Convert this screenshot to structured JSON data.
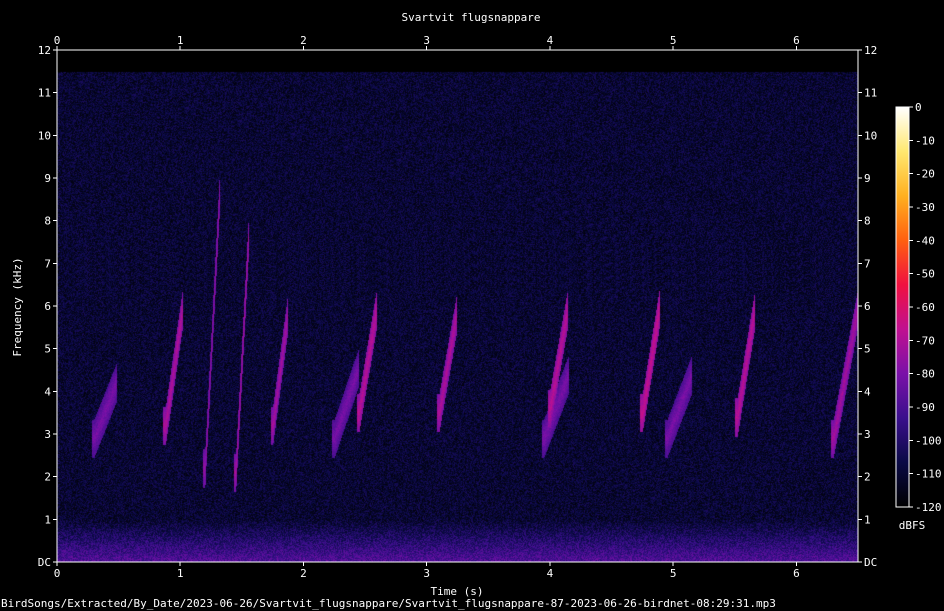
{
  "chart_data": {
    "type": "heatmap",
    "title": "Svartvit flugsnappare",
    "xlabel": "Time (s)",
    "ylabel": "Frequency (kHz)",
    "xlim": [
      0,
      6.5
    ],
    "ylim": [
      0,
      12
    ],
    "x_ticks": [
      "0",
      "1",
      "2",
      "3",
      "4",
      "5",
      "6"
    ],
    "y_ticks": [
      "DC",
      "1",
      "2",
      "3",
      "4",
      "5",
      "6",
      "7",
      "8",
      "9",
      "10",
      "11",
      "12"
    ],
    "colorbar": {
      "label": "dBFS",
      "range": [
        -120,
        0
      ],
      "ticks": [
        "0",
        "-10",
        "-20",
        "-30",
        "-40",
        "-50",
        "-60",
        "-70",
        "-80",
        "-90",
        "-100",
        "-110",
        "-120"
      ],
      "colors": [
        "#000000",
        "#0a0a45",
        "#3a0f8c",
        "#7a10a8",
        "#c01090",
        "#f01040",
        "#ff6010",
        "#ffb020",
        "#ffe870",
        "#ffffff"
      ]
    },
    "noise_floor_dbfs": -110,
    "low_band_kHz": [
      0,
      1
    ],
    "syllables": [
      {
        "t": 0.3,
        "dur": 0.18,
        "f_start": 2.9,
        "f_end": 4.2,
        "db": -80
      },
      {
        "t": 0.88,
        "dur": 0.14,
        "f_start": 3.2,
        "f_end": 6.0,
        "db": -70
      },
      {
        "t": 1.2,
        "dur": 0.12,
        "f_start": 2.2,
        "f_end": 8.8,
        "db": -75
      },
      {
        "t": 1.45,
        "dur": 0.1,
        "f_start": 2.1,
        "f_end": 7.5,
        "db": -72
      },
      {
        "t": 1.75,
        "dur": 0.12,
        "f_start": 3.2,
        "f_end": 5.8,
        "db": -72
      },
      {
        "t": 2.25,
        "dur": 0.2,
        "f_start": 2.9,
        "f_end": 4.6,
        "db": -80
      },
      {
        "t": 2.45,
        "dur": 0.14,
        "f_start": 3.5,
        "f_end": 5.9,
        "db": -68
      },
      {
        "t": 3.1,
        "dur": 0.14,
        "f_start": 3.5,
        "f_end": 5.8,
        "db": -70
      },
      {
        "t": 3.95,
        "dur": 0.2,
        "f_start": 2.9,
        "f_end": 4.4,
        "db": -80
      },
      {
        "t": 4.0,
        "dur": 0.14,
        "f_start": 3.6,
        "f_end": 5.9,
        "db": -68
      },
      {
        "t": 4.75,
        "dur": 0.14,
        "f_start": 3.5,
        "f_end": 6.0,
        "db": -66
      },
      {
        "t": 4.95,
        "dur": 0.2,
        "f_start": 2.9,
        "f_end": 4.4,
        "db": -80
      },
      {
        "t": 5.52,
        "dur": 0.14,
        "f_start": 3.4,
        "f_end": 5.9,
        "db": -68
      },
      {
        "t": 6.3,
        "dur": 0.2,
        "f_start": 2.9,
        "f_end": 6.0,
        "db": -72
      }
    ]
  },
  "footer": {
    "file_path": "BirdSongs/Extracted/By_Date/2023-06-26/Svartvit_flugsnappare/Svartvit_flugsnappare-87-2023-06-26-birdnet-08:29:31.mp3"
  }
}
